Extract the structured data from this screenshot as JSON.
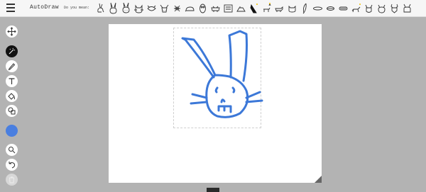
{
  "header": {
    "title": "AutoDraw",
    "did_you_mean": "Do you mean:"
  },
  "suggestions": [
    {
      "name": "rabbit-hopping"
    },
    {
      "name": "bunny-face"
    },
    {
      "name": "bunny-head"
    },
    {
      "name": "cat-face"
    },
    {
      "name": "horned-face"
    },
    {
      "name": "bull-face"
    },
    {
      "name": "spider"
    },
    {
      "name": "mouse"
    },
    {
      "name": "owl"
    },
    {
      "name": "cow-head"
    },
    {
      "name": "bus"
    },
    {
      "name": "box"
    },
    {
      "name": "fish"
    },
    {
      "name": "witch-hat"
    },
    {
      "name": "reindeer"
    },
    {
      "name": "dog"
    },
    {
      "name": "cat-sitting"
    },
    {
      "name": "feather"
    },
    {
      "name": "blimp"
    },
    {
      "name": "lips"
    },
    {
      "name": "hot-dog"
    },
    {
      "name": "dog-running"
    },
    {
      "name": "cat-head"
    },
    {
      "name": "deer"
    },
    {
      "name": "fox"
    }
  ],
  "tools": [
    {
      "name": "move-tool",
      "icon": "move-icon"
    },
    {
      "name": "autodraw-tool",
      "icon": "autodraw-icon"
    },
    {
      "name": "draw-tool",
      "icon": "pencil-icon"
    },
    {
      "name": "type-tool",
      "icon": "text-icon"
    },
    {
      "name": "fill-tool",
      "icon": "fill-icon"
    },
    {
      "name": "shape-tool",
      "icon": "shape-icon"
    },
    {
      "name": "color-picker",
      "icon": "color-swatch"
    },
    {
      "name": "zoom-tool",
      "icon": "zoom-icon"
    },
    {
      "name": "undo-tool",
      "icon": "undo-icon"
    },
    {
      "name": "delete-tool",
      "icon": "trash-icon"
    }
  ],
  "colors": {
    "stroke": "#3c78d8",
    "selected_color": "#4a7fe0",
    "background": "#b3b3b3",
    "topbar": "#f6f6f6"
  }
}
